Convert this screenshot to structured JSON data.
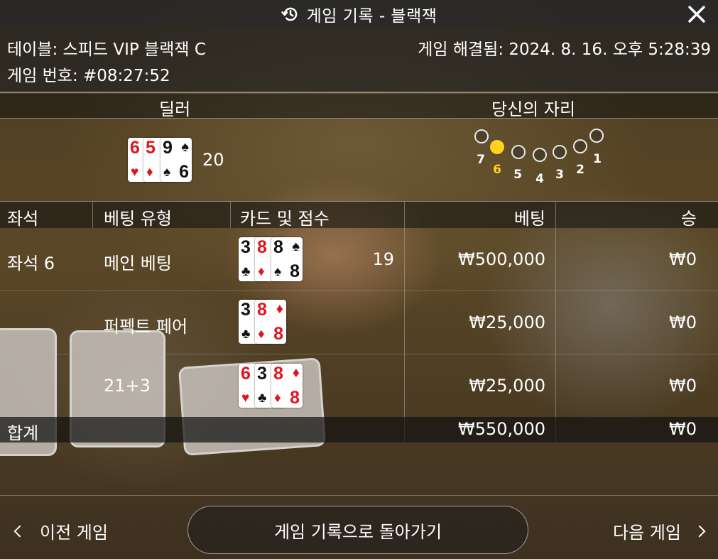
{
  "title_bar": {
    "icon": "history-icon",
    "title": "게임 기록 - 블랙잭",
    "close_icon": "close-icon"
  },
  "info": {
    "table": "테이블: 스피드 VIP 블랙잭 C",
    "game_id": "게임 번호: #08:27:52",
    "resolved": "게임 해결됨: 2024. 8. 16. 오후 5:28:39"
  },
  "sections": {
    "dealer": "딜러",
    "your_seat": "당신의 자리"
  },
  "dealer": {
    "cards": [
      {
        "rank": "6",
        "suit": "♥",
        "color": "red"
      },
      {
        "rank": "5",
        "suit": "♦",
        "color": "red"
      },
      {
        "rank": "9",
        "suit": "♠",
        "rank_bottom": "6",
        "color": "black"
      }
    ],
    "score": "20"
  },
  "seat_map": {
    "my_seat": "6",
    "seats": [
      "7",
      "6",
      "5",
      "4",
      "3",
      "2",
      "1"
    ],
    "highlight_color": "#ffd21f"
  },
  "table": {
    "headers": {
      "seat": "좌석",
      "bet_type": "베팅 유형",
      "cards_score": "카드 및 점수",
      "bet": "베팅",
      "win": "승"
    },
    "rows": [
      {
        "seat": "좌석 6",
        "bet_type": "메인 베팅",
        "cards": [
          {
            "rank": "3",
            "suit": "♣",
            "color": "black"
          },
          {
            "rank": "8",
            "suit": "♦",
            "color": "red"
          },
          {
            "rank": "8",
            "suit": "♠",
            "color": "black"
          }
        ],
        "score": "19",
        "bet": "₩500,000",
        "win": "₩0"
      },
      {
        "seat": "",
        "bet_type": "퍼펙트 페어",
        "cards": [
          {
            "rank": "3",
            "suit": "♣",
            "color": "black"
          },
          {
            "rank": "8",
            "suit": "♦",
            "color": "red"
          }
        ],
        "score": "",
        "bet": "₩25,000",
        "win": "₩0"
      },
      {
        "seat": "",
        "bet_type": "21+3",
        "cards": [
          {
            "rank": "6",
            "suit": "♥",
            "color": "red"
          },
          {
            "rank": "3",
            "suit": "♣",
            "color": "black"
          },
          {
            "rank": "8",
            "suit": "♦",
            "color": "red"
          }
        ],
        "score": "",
        "bet": "₩25,000",
        "win": "₩0"
      }
    ],
    "total": {
      "label": "합계",
      "bet": "₩550,000",
      "win": "₩0"
    }
  },
  "footer": {
    "prev": "이전 게임",
    "back": "게임 기록으로 돌아가기",
    "next": "다음 게임"
  }
}
